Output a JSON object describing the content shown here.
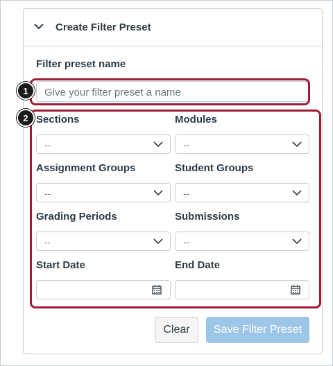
{
  "panel": {
    "title": "Create Filter Preset",
    "icon": "chevron-down-icon"
  },
  "preset_name": {
    "label": "Filter preset name",
    "placeholder": "Give your filter preset a name"
  },
  "filters": {
    "sections": {
      "label": "Sections",
      "value": "--"
    },
    "modules": {
      "label": "Modules",
      "value": "--"
    },
    "assignment_groups": {
      "label": "Assignment Groups",
      "value": "--"
    },
    "student_groups": {
      "label": "Student Groups",
      "value": "--"
    },
    "grading_periods": {
      "label": "Grading Periods",
      "value": "--"
    },
    "submissions": {
      "label": "Submissions",
      "value": "--"
    },
    "start_date": {
      "label": "Start Date",
      "value": ""
    },
    "end_date": {
      "label": "End Date",
      "value": ""
    }
  },
  "buttons": {
    "clear": "Clear",
    "save": "Save Filter Preset"
  },
  "callouts": {
    "one": "1",
    "two": "2"
  },
  "colors": {
    "callout": "#9e1b32",
    "save_button": "#9dc5e8",
    "text": "#2d3b45"
  }
}
